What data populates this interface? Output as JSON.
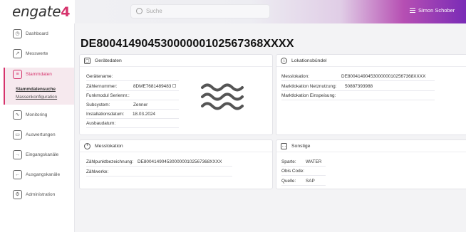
{
  "app": {
    "logo_text": "engate",
    "logo_mark": "4"
  },
  "header": {
    "search_placeholder": "Suche",
    "user_name": "Simon Schober"
  },
  "sidebar": {
    "items": [
      {
        "label": "Dashboard",
        "icon": "dashboard-icon"
      },
      {
        "label": "Messwerte",
        "icon": "chart-icon"
      },
      {
        "label": "Stammdaten",
        "icon": "database-icon"
      },
      {
        "label": "Monitoring",
        "icon": "monitor-icon"
      },
      {
        "label": "Auswertungen",
        "icon": "report-icon"
      },
      {
        "label": "Eingangskanäle",
        "icon": "inbox-icon"
      },
      {
        "label": "Ausgangskanäle",
        "icon": "outbox-icon"
      },
      {
        "label": "Administration",
        "icon": "settings-icon"
      }
    ],
    "sub_items": [
      {
        "label": "Stammdatensuche"
      },
      {
        "label": "Massenkonfiguration"
      }
    ]
  },
  "main": {
    "title": "DE80041490453000000102567368XXXX",
    "geraetedaten": {
      "title": "Gerätedaten",
      "rows": [
        {
          "label": "Gerätename:",
          "value": ""
        },
        {
          "label": "Zählernummer:",
          "value": "8DME7681489483"
        },
        {
          "label": "Funkmodul Seriennr.:",
          "value": ""
        },
        {
          "label": "Subsystem:",
          "value": "Zenner"
        },
        {
          "label": "Installationsdatum:",
          "value": "18.03.2024"
        },
        {
          "label": "Ausbaudatum:",
          "value": ""
        }
      ]
    },
    "lokationsbuendel": {
      "title": "Lokationsbündel",
      "rows": [
        {
          "label": "Messlokation:",
          "value": "DE80041490453000000102567368XXXX"
        },
        {
          "label": "Marktlokation Netznutzung:",
          "value": "50887393988"
        },
        {
          "label": "Marktlokation Einspeisung:",
          "value": ""
        }
      ]
    },
    "messlokation": {
      "title": "Messlokation",
      "rows": [
        {
          "label": "Zählpunktbezeichnung:",
          "value": "DE80041490453000000102567368XXXX"
        },
        {
          "label": "Zählwerke:",
          "value": ""
        }
      ]
    },
    "sonstige": {
      "title": "Sonstige",
      "rows": [
        {
          "label": "Sparte:",
          "value": "WATER"
        },
        {
          "label": "Obis Code:",
          "value": ""
        },
        {
          "label": "Quelle:",
          "value": "SAP"
        }
      ]
    }
  },
  "colors": {
    "accent": "#d6336c",
    "header_gradient_end": "#7a2bb6"
  }
}
